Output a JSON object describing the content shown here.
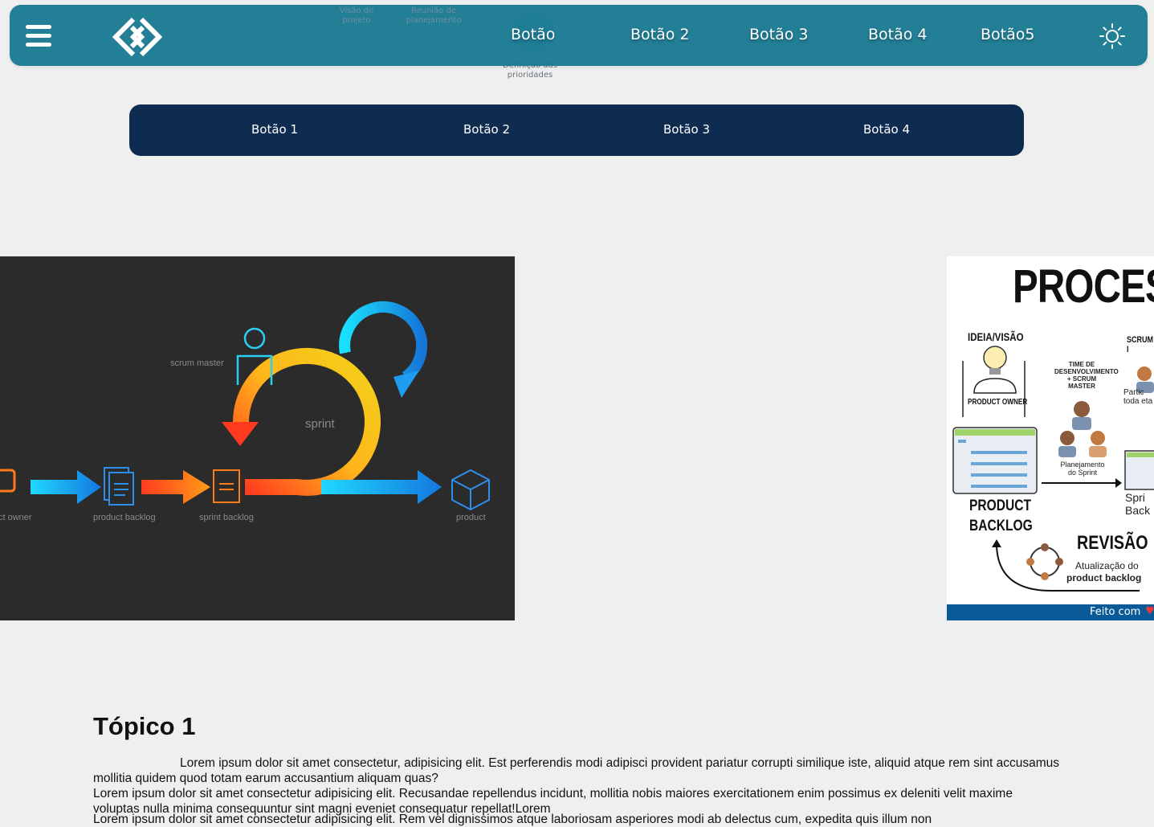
{
  "navbar": {
    "links": [
      "Botão",
      "Botão 2",
      "Botão 3",
      "Botão 4",
      "Botão5"
    ],
    "icons": {
      "menu": "hamburger-icon",
      "logo": "diamond-logo",
      "theme": "sun-icon"
    }
  },
  "ghost_diagram": {
    "caption_1": "Visão do projeto",
    "caption_2": "Reunião de planejamento",
    "caption_3": "Definição das prioridades"
  },
  "subnav": {
    "links": [
      "Botão 1",
      "Botão 2",
      "Botão 3",
      "Botão 4"
    ]
  },
  "carousel": {
    "left_image": {
      "labels": {
        "scrum_master": "scrum master",
        "sprint": "sprint",
        "product_owner": "ct owner",
        "product_backlog": "product backlog",
        "sprint_backlog": "sprint backlog",
        "product": "product"
      }
    },
    "right_image": {
      "title": "PROCES",
      "ideia": "IDEIA/VISÃO",
      "scrum": "SCRUM I",
      "time_dev": "TIME DE DESENVOLVIMENTO + SCRUM MASTER",
      "product_owner": "PRODUCT OWNER",
      "partic": "Partic toda eta",
      "planejamento": "Planejamento do Sprint",
      "product_backlog": "PRODUCT BACKLOG",
      "sprint_backlog": "Spri Back",
      "revisao": "REVISÃO",
      "atualizacao": "Atualização do",
      "atualizacao_bold": "product backlog",
      "footer": "Feito com"
    }
  },
  "topic": {
    "title": "Tópico 1",
    "paragraph_1": "Lorem ipsum dolor sit amet consectetur, adipisicing elit. Est perferendis modi adipisci provident pariatur corrupti similique iste, aliquid atque rem sint accusamus mollitia quidem quod totam earum accusantium aliquam quas?",
    "paragraph_2": "Lorem ipsum dolor sit amet consectetur adipisicing elit. Recusandae repellendus incidunt, mollitia nobis maiores exercitationem enim possimus ex deleniti velit maxime voluptas nulla minima consequuntur sint magni eveniet consequatur repellat!Lorem",
    "paragraph_3": "Lorem ipsum dolor sit amet consectetur adipisicing elit. Rem vel dignissimos atque laboriosam asperiores modi ab delectus cum, expedita quis illum non"
  },
  "colors": {
    "navbar": "#16788f",
    "subnav": "#0e2b50",
    "background": "#efefef"
  }
}
